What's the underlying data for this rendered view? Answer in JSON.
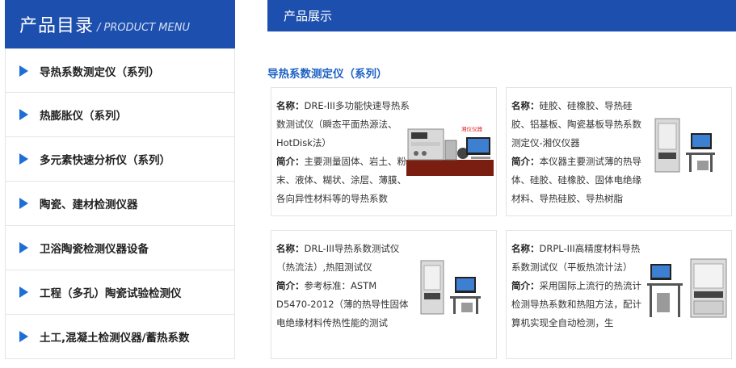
{
  "sidebar": {
    "title_cn": "产品目录",
    "title_en": "/ PRODUCT MENU",
    "items": [
      {
        "label": "导热系数测定仪（系列）"
      },
      {
        "label": "热膨胀仪（系列）"
      },
      {
        "label": "多元素快速分析仪（系列）"
      },
      {
        "label": "陶瓷、建材检测仪器"
      },
      {
        "label": "卫浴陶瓷检测仪器设备"
      },
      {
        "label": "工程（多孔）陶瓷试验检测仪"
      },
      {
        "label": "土工,混凝土检测仪器/蓄热系数"
      }
    ]
  },
  "main": {
    "header": "产品展示",
    "category_title": "导热系数测定仪（系列）",
    "name_label": "名称：",
    "intro_label": "简介：",
    "products": [
      {
        "name": "DRE-III多功能快速导热系数测试仪（瞬态平面热源法、HotDisk法）",
        "intro": "主要测量固体、岩土、粉末、液体、糊状、涂层、薄膜、各向异性材料等的导热系数"
      },
      {
        "name": "硅胶、硅橡胶、导热硅胶、铝基板、陶瓷基板导热系数测定仪-湘仪仪器",
        "intro": "本仪器主要测试薄的热导体、硅胶、硅橡胶、固体电绝缘材料、导热硅胶、导热树脂"
      },
      {
        "name": "DRL-III导热系数测试仪（热流法）,热阻测试仪",
        "intro": "参考标准：ASTM D5470-2012（薄的热导性固体电绝缘材料传热性能的测试"
      },
      {
        "name": "DRPL-III高精度材料导热系数测试仪（平板热流计法）",
        "intro": "采用国际上流行的热流计检测导热系数和热阻方法，配计算机实现全自动检测，生"
      }
    ],
    "image_watermark": "湘仪仪器"
  }
}
